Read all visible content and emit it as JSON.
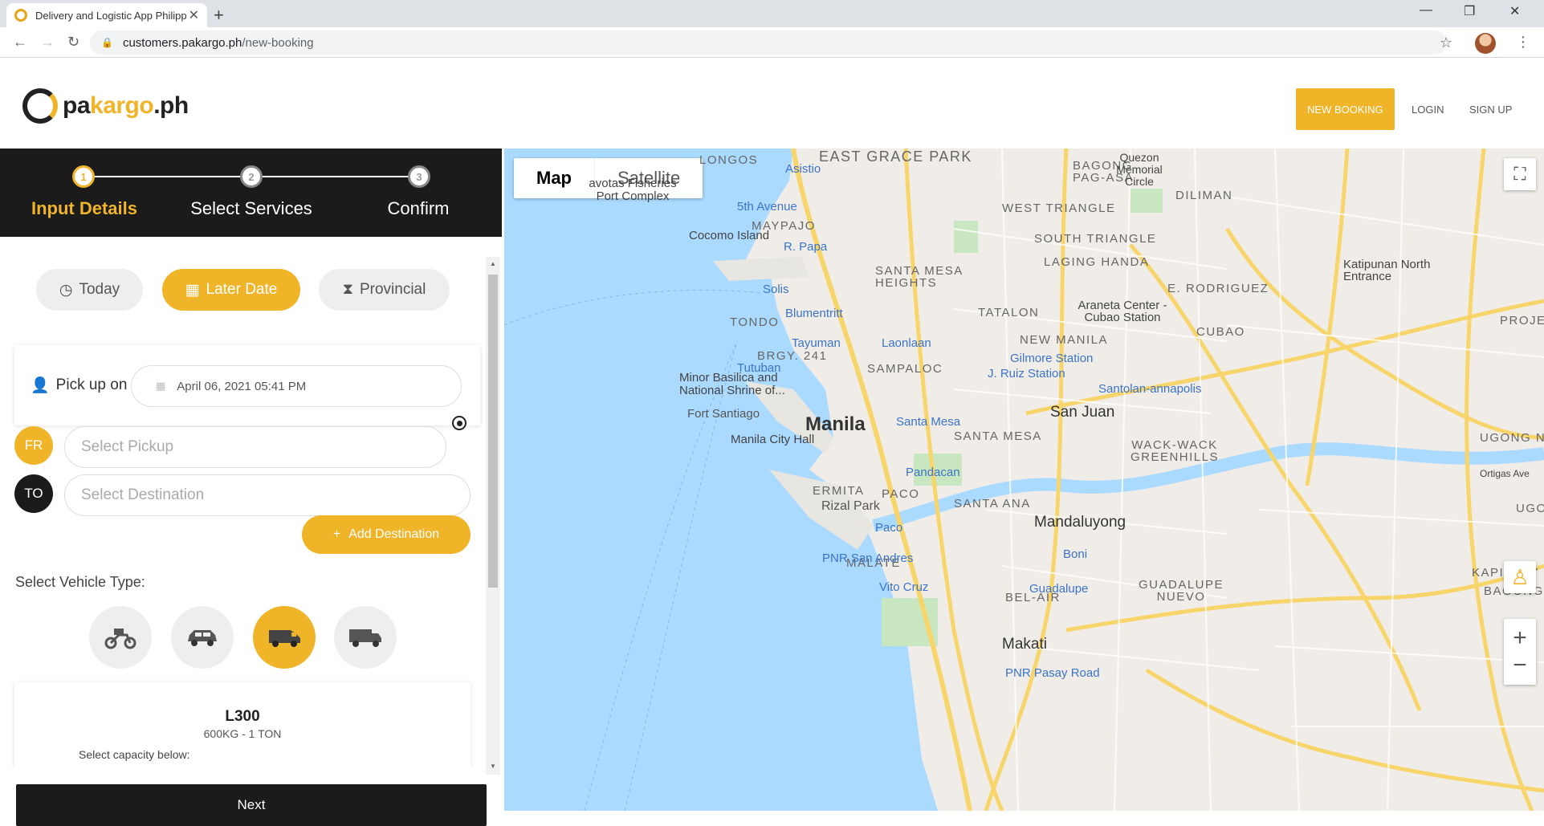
{
  "browser": {
    "tab_title": "Delivery and Logistic App Philipp",
    "url_host": "customers.pakargo.ph",
    "url_path": "/new-booking"
  },
  "header": {
    "logo_prefix": "pa",
    "logo_accent": "kargo",
    "logo_suffix": ".ph",
    "new_booking": "NEW BOOKING",
    "login": "LOGIN",
    "signup": "SIGN UP"
  },
  "stepper": {
    "steps": [
      {
        "num": "1",
        "label": "Input Details"
      },
      {
        "num": "2",
        "label": "Select Services"
      },
      {
        "num": "3",
        "label": "Confirm"
      }
    ]
  },
  "schedule": {
    "today": "Today",
    "later": "Later Date",
    "provincial": "Provincial"
  },
  "pickup": {
    "label": "Pick up on",
    "date": "April 06, 2021 05:41 PM"
  },
  "locations": {
    "from_badge": "FR",
    "to_badge": "TO",
    "pickup_placeholder": "Select Pickup",
    "destination_placeholder": "Select Destination",
    "add_destination": "Add Destination"
  },
  "vehicle": {
    "section_label": "Select Vehicle Type:",
    "types": [
      "motorcycle",
      "sedan",
      "van",
      "truck"
    ],
    "selected": {
      "name": "L300",
      "capacity": "600KG - 1 TON",
      "select_capacity": "Select capacity below:"
    }
  },
  "actions": {
    "next": "Next"
  },
  "map": {
    "type_map": "Map",
    "type_satellite": "Satellite",
    "labels": {
      "manila": "Manila",
      "san_juan": "San Juan",
      "mandaluyong": "Mandaluyong",
      "makati": "Makati",
      "east_grace_park": "EAST GRACE PARK",
      "longos": "LONGOS",
      "maypajo": "MAYPAJO",
      "tondo": "TONDO",
      "sampaloc": "SAMPALOC",
      "santa_mesa": "SANTA MESA",
      "santa_mesa_heights": "SANTA MESA HEIGHTS",
      "tatalon": "TATALON",
      "new_manila": "NEW MANILA",
      "cubao": "CUBAO",
      "ermita": "ERMITA",
      "paco": "PACO",
      "malate": "MALATE",
      "santa_ana": "SANTA ANA",
      "bel_air": "BEL-AIR",
      "guadalupe_nuevo": "GUADALUPE NUEVO",
      "cocomo_island": "Cocomo Island",
      "fort_santiago": "Fort Santiago",
      "rizal_park": "Rizal Park",
      "manila_city_hall": "Manila City Hall",
      "minor_basilica": "Minor Basilica and National Shrine of...",
      "navotas": "avotas Fisheries Port Complex",
      "quezon_memorial": "Quezon Memorial Circle",
      "araneta": "Araneta Center - Cubao Station",
      "diliman": "DILIMAN",
      "west_triangle": "WEST TRIANGLE",
      "south_triangle": "SOUTH TRIANGLE",
      "laging_handa": "LAGING HANDA",
      "e_rodriguez": "E. RODRIGUEZ",
      "katipunan": "Katipunan North Entrance",
      "bagong_pag_asa": "BAGONG PAG-ASA",
      "asistio": "Asistio",
      "fifth_avenue": "5th Avenue",
      "r_papa": "R. Papa",
      "solis": "Solis",
      "blumentritt": "Blumentritt",
      "tayuman": "Tayuman",
      "laonlaan": "Laonlaan",
      "tutuban": "Tutuban",
      "brgy_241": "BRGY. 241",
      "gilmore": "Gilmore Station",
      "j_ruiz": "J. Ruiz Station",
      "santolan": "Santolan-annapolis",
      "santa_mesa_stn": "Santa Mesa",
      "pandacan": "Pandacan",
      "paco_stn": "Paco",
      "pnr_san_andres": "PNR San Andres",
      "vito_cruz": "Vito Cruz",
      "boni": "Boni",
      "guadalupe": "Guadalupe",
      "pnr_pasay": "PNR Pasay Road",
      "wack_wack": "WACK-WACK GREENHILLS",
      "kapitolyo": "KAPITOLY",
      "bagong_i": "BAGONG I",
      "ugong_n": "UGONG N",
      "ugong": "UGO",
      "projec": "PROJEC",
      "ortigas": "Ortigas Ave"
    }
  },
  "colors": {
    "brand_yellow": "#f0b429",
    "dark": "#1b1b1b",
    "water": "#aadaff"
  }
}
